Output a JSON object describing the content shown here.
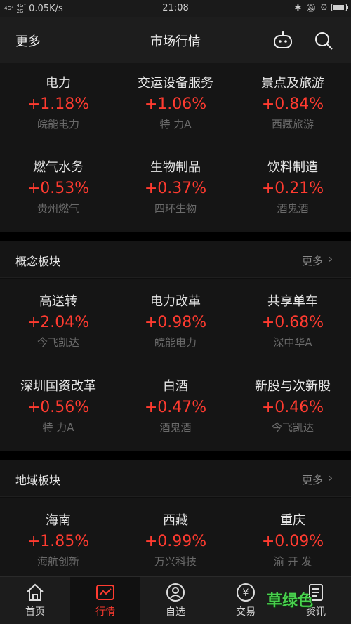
{
  "status_bar": {
    "signal1": "4G⁺",
    "signal2_top": "4G⁺",
    "signal2_bottom": "2G",
    "speed": "0.05K/s",
    "time": "21:08",
    "icons": [
      "bluetooth-icon",
      "mute-icon",
      "alarm-icon",
      "battery-icon"
    ],
    "battery_level": 0.9
  },
  "nav": {
    "more": "更多",
    "title": "市场行情"
  },
  "industry": {
    "cells": [
      {
        "name": "电力",
        "pct": "+1.18%",
        "stock": "皖能电力"
      },
      {
        "name": "交运设备服务",
        "pct": "+1.06%",
        "stock": "特 力A"
      },
      {
        "name": "景点及旅游",
        "pct": "+0.84%",
        "stock": "西藏旅游"
      },
      {
        "name": "燃气水务",
        "pct": "+0.53%",
        "stock": "贵州燃气"
      },
      {
        "name": "生物制品",
        "pct": "+0.37%",
        "stock": "四环生物"
      },
      {
        "name": "饮料制造",
        "pct": "+0.21%",
        "stock": "酒鬼酒"
      }
    ]
  },
  "concept": {
    "label": "概念板块",
    "more": "更多",
    "cells": [
      {
        "name": "高送转",
        "pct": "+2.04%",
        "stock": "今飞凯达"
      },
      {
        "name": "电力改革",
        "pct": "+0.98%",
        "stock": "皖能电力"
      },
      {
        "name": "共享单车",
        "pct": "+0.68%",
        "stock": "深中华A"
      },
      {
        "name": "深圳国资改革",
        "pct": "+0.56%",
        "stock": "特 力A"
      },
      {
        "name": "白酒",
        "pct": "+0.47%",
        "stock": "酒鬼酒"
      },
      {
        "name": "新股与次新股",
        "pct": "+0.46%",
        "stock": "今飞凯达"
      }
    ]
  },
  "region": {
    "label": "地域板块",
    "more": "更多",
    "cells": [
      {
        "name": "海南",
        "pct": "+1.85%",
        "stock": "海航创新"
      },
      {
        "name": "西藏",
        "pct": "+0.99%",
        "stock": "万兴科技"
      },
      {
        "name": "重庆",
        "pct": "+0.09%",
        "stock": "渝 开 发"
      }
    ]
  },
  "tabs": [
    {
      "label": "首页",
      "icon": "home-icon",
      "active": false
    },
    {
      "label": "行情",
      "icon": "chart-icon",
      "active": true
    },
    {
      "label": "自选",
      "icon": "user-icon",
      "active": false
    },
    {
      "label": "交易",
      "icon": "yuan-icon",
      "active": false
    },
    {
      "label": "资讯",
      "icon": "news-icon",
      "active": false
    }
  ],
  "watermark": "草绿色",
  "colors": {
    "up": "#ff3b30",
    "accent": "#ff3b30"
  }
}
